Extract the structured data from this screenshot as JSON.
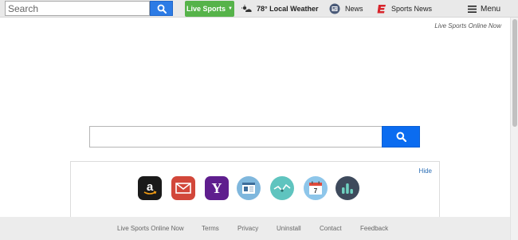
{
  "toolbar": {
    "search_placeholder": "Search",
    "live_sports_label": "Live Sports",
    "weather_label": "78° Local Weather",
    "news_label": "News",
    "sports_news_label": "Sports News",
    "menu_label": "Menu"
  },
  "brand_tag": "Live Sports Online Now",
  "panel": {
    "hide_label": "Hide",
    "tiles": [
      "amazon",
      "gmail",
      "yahoo",
      "news",
      "weather",
      "calendar",
      "stats"
    ]
  },
  "footer": {
    "links": [
      "Live Sports Online Now",
      "Terms",
      "Privacy",
      "Uninstall",
      "Contact",
      "Feedback"
    ]
  },
  "colors": {
    "search_blue": "#2c7be5",
    "live_green": "#56b34a",
    "main_search_blue": "#0b6cf0",
    "link_blue": "#2a6db5"
  }
}
